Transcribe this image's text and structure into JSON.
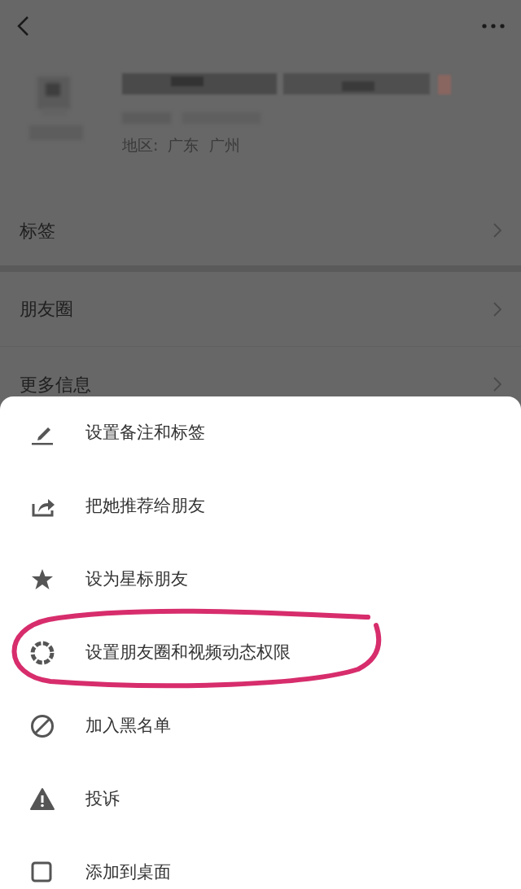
{
  "profile": {
    "region": "地区:  广东  广州"
  },
  "rows": [
    {
      "label": "标签"
    },
    {
      "label": "朋友圈"
    },
    {
      "label": "更多信息"
    }
  ],
  "menu": [
    {
      "kind": "edit",
      "label": "设置备注和标签"
    },
    {
      "kind": "share",
      "label": "把她推荐给朋友"
    },
    {
      "kind": "star",
      "label": "设为星标朋友"
    },
    {
      "kind": "moments",
      "label": "设置朋友圈和视频动态权限"
    },
    {
      "kind": "block",
      "label": "加入黑名单"
    },
    {
      "kind": "report",
      "label": "投诉"
    },
    {
      "kind": "desktop",
      "label": "添加到桌面"
    }
  ]
}
